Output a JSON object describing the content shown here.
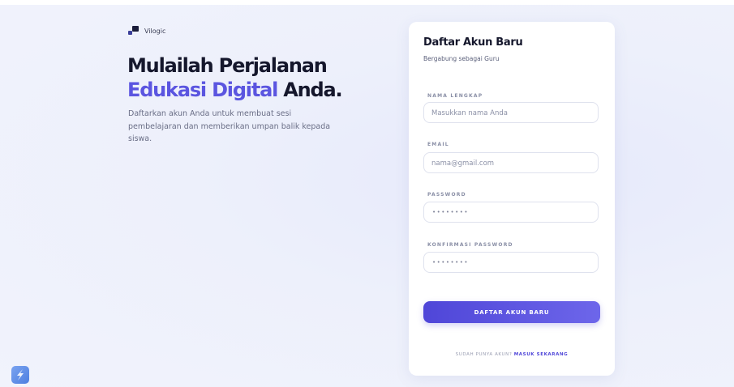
{
  "brand": {
    "name": "Vilogic"
  },
  "hero": {
    "line1": "Mulailah Perjalanan",
    "highlight": "Edukasi Digital",
    "line2_end": "Anda.",
    "description": "Daftarkan akun Anda untuk membuat sesi pembelajaran dan memberikan umpan balik kepada siswa."
  },
  "form": {
    "title": "Daftar Akun Baru",
    "subtitle": "Bergabung sebagai Guru",
    "fields": {
      "name": {
        "label": "NAMA LENGKAP",
        "placeholder": "Masukkan nama Anda"
      },
      "email": {
        "label": "EMAIL",
        "placeholder": "nama@gmail.com"
      },
      "password": {
        "label": "PASSWORD",
        "mask": "••••••••"
      },
      "confirm": {
        "label": "KONFIRMASI PASSWORD",
        "mask": "••••••••"
      }
    },
    "submit_label": "DAFTAR AKUN BARU",
    "footer_question": "SUDAH PUNYA AKUN?",
    "footer_link": "MASUK SEKARANG"
  },
  "colors": {
    "accent": "#5b55e0",
    "button": "#4f46d8",
    "background": "#edf0fb"
  },
  "icons": {
    "brand": "vilogic-logo-icon",
    "corner": "app-badge-icon"
  }
}
